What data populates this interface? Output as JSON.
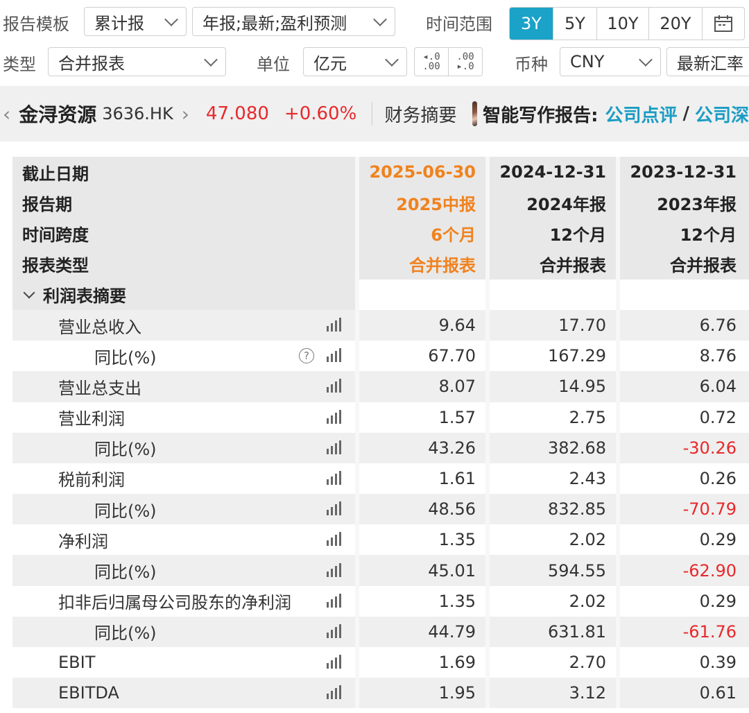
{
  "toolbar": {
    "template_label": "报告模板",
    "template_value": "累计报",
    "report_value": "年报;最新;盈利预测",
    "range_label": "时间范围",
    "range_options": [
      "3Y",
      "5Y",
      "10Y",
      "20Y"
    ],
    "range_active": "3Y",
    "type_label": "类型",
    "type_value": "合并报表",
    "unit_label": "单位",
    "unit_value": "亿元",
    "currency_label": "币种",
    "currency_value": "CNY",
    "rate_value": "最新汇率"
  },
  "stock": {
    "name": "金浔资源",
    "code": "3636.HK",
    "price": "47.080",
    "change": "+0.60%",
    "section": "财务摘要",
    "ai_label": "智能写作报告:",
    "link1": "公司点评",
    "separator": "/",
    "link2": "公司深"
  },
  "table": {
    "header_rows": [
      {
        "label": "截止日期",
        "values": [
          "2025-06-30",
          "2024-12-31",
          "2023-12-31"
        ]
      },
      {
        "label": "报告期",
        "values": [
          "2025中报",
          "2024年报",
          "2023年报"
        ]
      },
      {
        "label": "时间跨度",
        "values": [
          "6个月",
          "12个月",
          "12个月"
        ]
      },
      {
        "label": "报表类型",
        "values": [
          "合并报表",
          "合并报表",
          "合并报表"
        ]
      }
    ],
    "section_title": "利润表摘要",
    "rows": [
      {
        "label": "营业总收入",
        "values": [
          "9.64",
          "17.70",
          "6.76"
        ]
      },
      {
        "label": "同比(%)",
        "values": [
          "67.70",
          "167.29",
          "8.76"
        ],
        "help": "?"
      },
      {
        "label": "营业总支出",
        "values": [
          "8.07",
          "14.95",
          "6.04"
        ]
      },
      {
        "label": "营业利润",
        "values": [
          "1.57",
          "2.75",
          "0.72"
        ]
      },
      {
        "label": "同比(%)",
        "values": [
          "43.26",
          "382.68",
          "-30.26"
        ]
      },
      {
        "label": "税前利润",
        "values": [
          "1.61",
          "2.43",
          "0.26"
        ]
      },
      {
        "label": "同比(%)",
        "values": [
          "48.56",
          "832.85",
          "-70.79"
        ]
      },
      {
        "label": "净利润",
        "values": [
          "1.35",
          "2.02",
          "0.29"
        ]
      },
      {
        "label": "同比(%)",
        "values": [
          "45.01",
          "594.55",
          "-62.90"
        ]
      },
      {
        "label": "扣非后归属母公司股东的净利润",
        "values": [
          "1.35",
          "2.02",
          "0.29"
        ]
      },
      {
        "label": "同比(%)",
        "values": [
          "44.79",
          "631.81",
          "-61.76"
        ]
      },
      {
        "label": "EBIT",
        "values": [
          "1.69",
          "2.70",
          "0.39"
        ]
      },
      {
        "label": "EBITDA",
        "values": [
          "1.95",
          "3.12",
          "0.61"
        ]
      }
    ]
  },
  "colors": {
    "accent": "#1aa2c8",
    "up": "#e8282b",
    "latest": "#f0821e",
    "link": "#1a9cc4"
  }
}
